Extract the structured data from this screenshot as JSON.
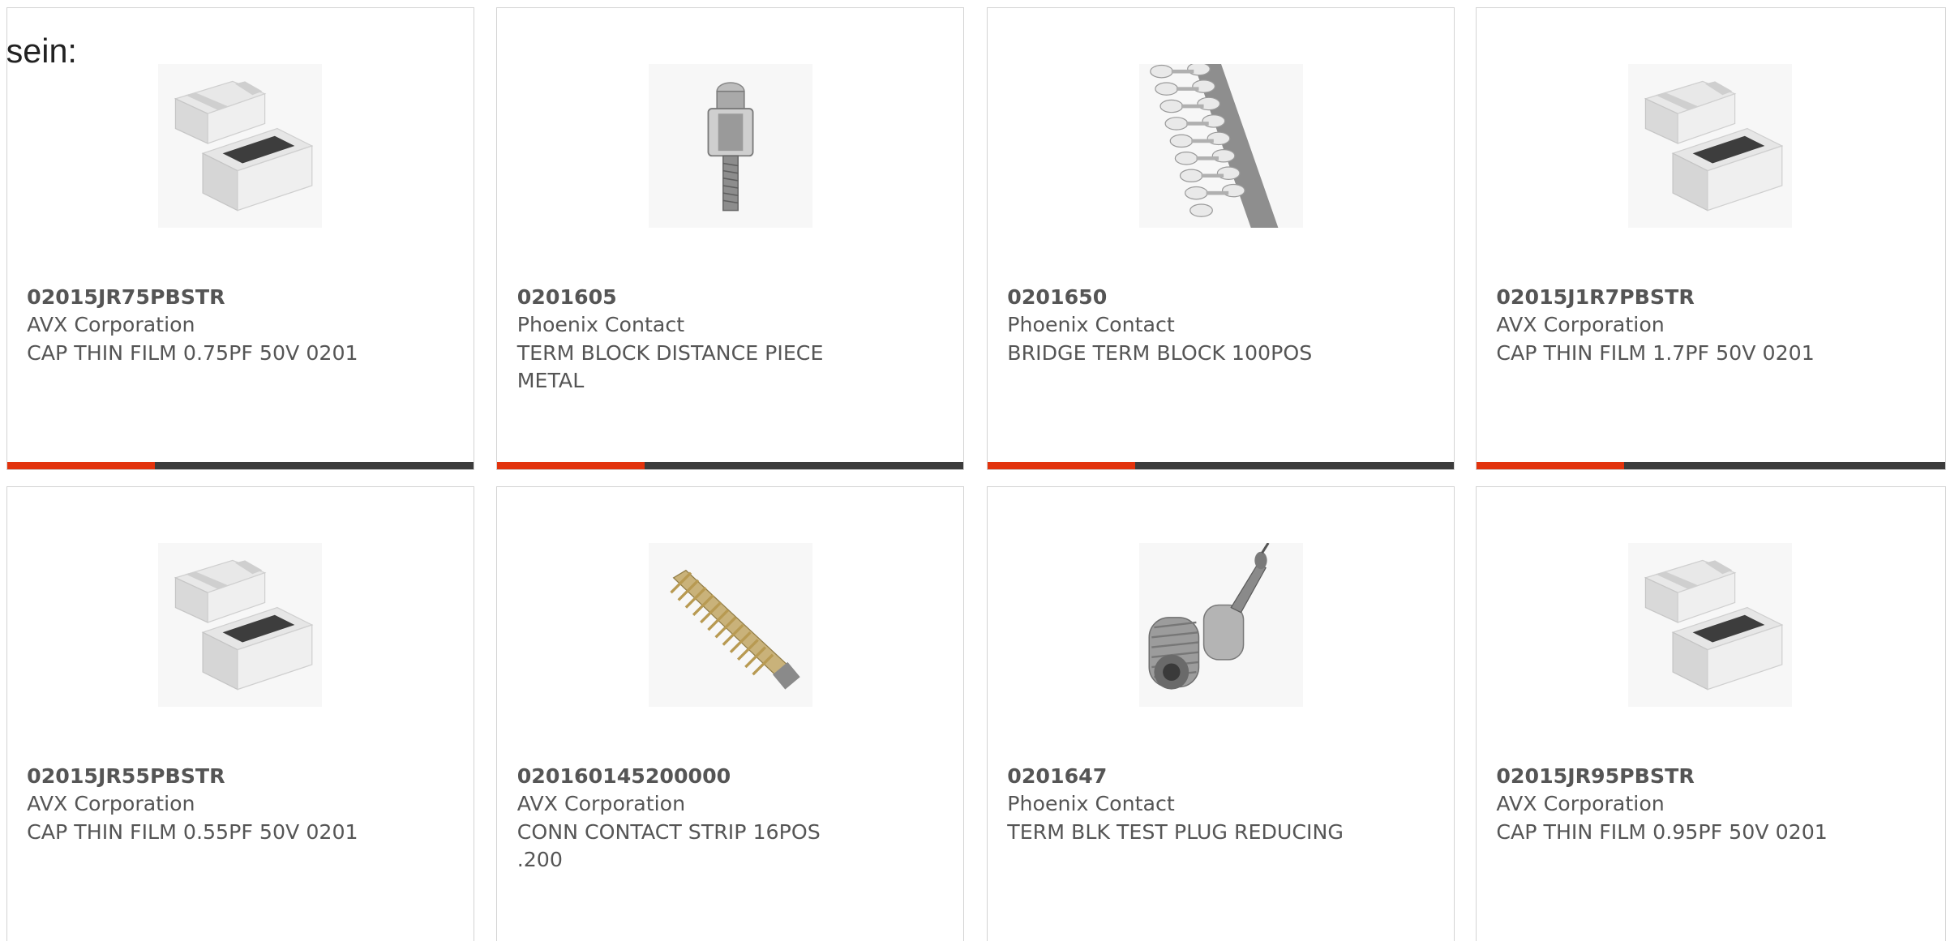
{
  "intro_text": "sein:",
  "accent_color": "#e2330d",
  "bar_color": "#3c3c3c",
  "cards": [
    {
      "part_number": "02015JR75PBSTR",
      "manufacturer": "AVX Corporation",
      "description": "CAP THIN FILM 0.75PF 50V 0201",
      "image": "capacitor-chip-image"
    },
    {
      "part_number": "0201605",
      "manufacturer": "Phoenix Contact",
      "description": "TERM BLOCK DISTANCE PIECE METAL",
      "image": "screw-distance-piece-image"
    },
    {
      "part_number": "0201650",
      "manufacturer": "Phoenix Contact",
      "description": "BRIDGE TERM BLOCK 100POS",
      "image": "bridge-comb-image"
    },
    {
      "part_number": "02015J1R7PBSTR",
      "manufacturer": "AVX Corporation",
      "description": "CAP THIN FILM 1.7PF 50V 0201",
      "image": "capacitor-chip-image"
    },
    {
      "part_number": "02015JR55PBSTR",
      "manufacturer": "AVX Corporation",
      "description": "CAP THIN FILM 0.55PF 50V 0201",
      "image": "capacitor-chip-image"
    },
    {
      "part_number": "020160145200000",
      "manufacturer": "AVX Corporation",
      "description": "CONN CONTACT STRIP 16POS .200",
      "image": "contact-strip-image"
    },
    {
      "part_number": "0201647",
      "manufacturer": "Phoenix Contact",
      "description": "TERM BLK TEST PLUG REDUCING",
      "image": "test-plug-image"
    },
    {
      "part_number": "02015JR95PBSTR",
      "manufacturer": "AVX Corporation",
      "description": "CAP THIN FILM 0.95PF 50V 0201",
      "image": "capacitor-chip-image"
    }
  ]
}
